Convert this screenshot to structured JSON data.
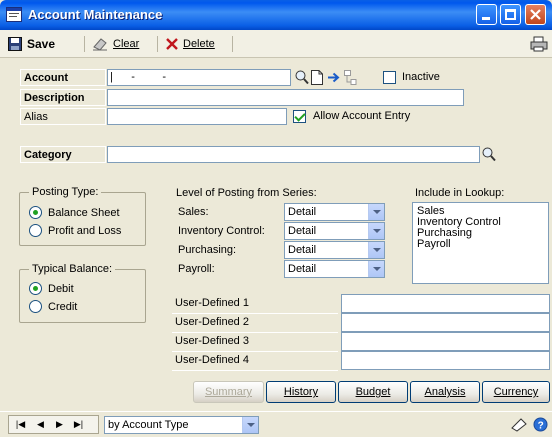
{
  "window": {
    "title": "Account Maintenance"
  },
  "toolbar": {
    "save": "Save",
    "clear": "Clear",
    "delete": "Delete"
  },
  "fields": {
    "account_label": "Account",
    "account_value": "|      -         -",
    "inactive_label": "Inactive",
    "description_label": "Description",
    "alias_label": "Alias",
    "allow_entry_label": "Allow Account Entry",
    "category_label": "Category"
  },
  "posting_type": {
    "label": "Posting Type:",
    "options": [
      "Balance Sheet",
      "Profit and Loss"
    ],
    "selected": "Balance Sheet"
  },
  "typical_balance": {
    "label": "Typical Balance:",
    "options": [
      "Debit",
      "Credit"
    ],
    "selected": "Debit"
  },
  "level_of_posting": {
    "label": "Level of Posting from Series:",
    "rows": [
      {
        "label": "Sales:",
        "value": "Detail"
      },
      {
        "label": "Inventory Control:",
        "value": "Detail"
      },
      {
        "label": "Purchasing:",
        "value": "Detail"
      },
      {
        "label": "Payroll:",
        "value": "Detail"
      }
    ]
  },
  "lookup": {
    "label": "Include in Lookup:",
    "items": [
      "Sales",
      "Inventory Control",
      "Purchasing",
      "Payroll"
    ]
  },
  "user_defined": [
    "User-Defined 1",
    "User-Defined 2",
    "User-Defined 3",
    "User-Defined 4"
  ],
  "buttons": {
    "summary": "Summary",
    "history": "History",
    "budget": "Budget",
    "analysis": "Analysis",
    "currency": "Currency"
  },
  "statusbar": {
    "sort": "by Account Type"
  }
}
